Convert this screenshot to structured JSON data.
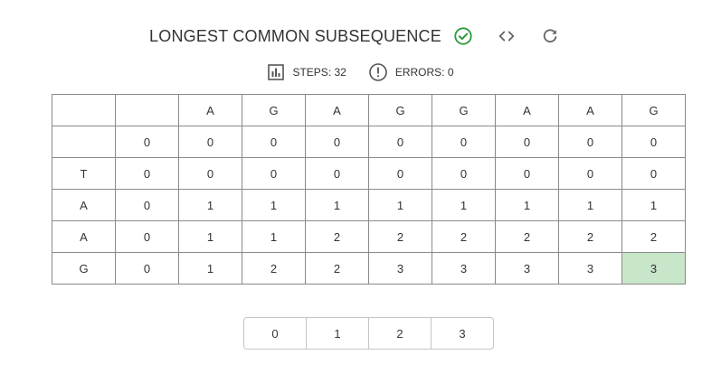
{
  "header": {
    "title": "LONGEST COMMON SUBSEQUENCE"
  },
  "icons": {
    "status": "check-circle-icon",
    "code": "code-icon",
    "refresh": "refresh-icon",
    "steps": "bar-chart-icon",
    "errors": "error-outline-icon"
  },
  "colors": {
    "success": "#2e9a3a",
    "highlight_cell": "#c8e6c9",
    "icon_gray": "#666666"
  },
  "stats": {
    "steps_label": "STEPS: 32",
    "errors_label": "ERRORS: 0"
  },
  "table": {
    "rows": [
      [
        "",
        "",
        "A",
        "G",
        "A",
        "G",
        "G",
        "A",
        "A",
        "G"
      ],
      [
        "",
        "0",
        "0",
        "0",
        "0",
        "0",
        "0",
        "0",
        "0",
        "0"
      ],
      [
        "T",
        "0",
        "0",
        "0",
        "0",
        "0",
        "0",
        "0",
        "0",
        "0"
      ],
      [
        "A",
        "0",
        "1",
        "1",
        "1",
        "1",
        "1",
        "1",
        "1",
        "1"
      ],
      [
        "A",
        "0",
        "1",
        "1",
        "2",
        "2",
        "2",
        "2",
        "2",
        "2"
      ],
      [
        "G",
        "0",
        "1",
        "2",
        "2",
        "3",
        "3",
        "3",
        "3",
        "3"
      ]
    ],
    "highlighted_cell": {
      "row": 5,
      "col": 9
    }
  },
  "answer_options": [
    "0",
    "1",
    "2",
    "3"
  ]
}
